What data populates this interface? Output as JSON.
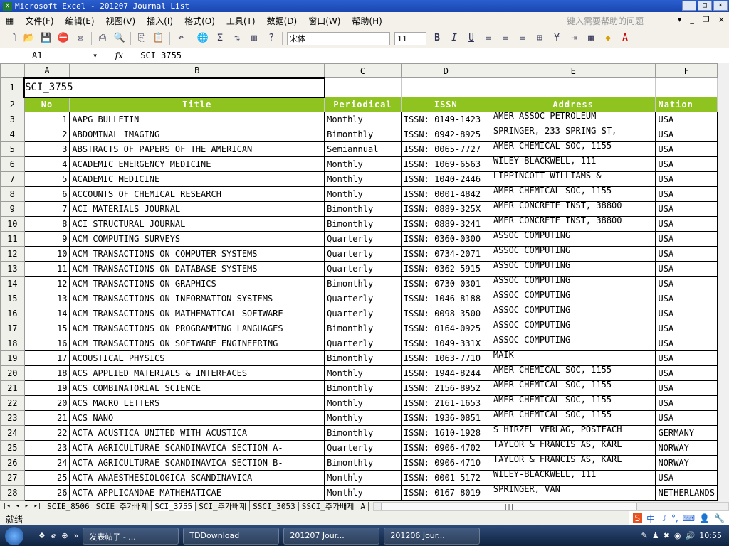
{
  "window": {
    "title": "Microsoft Excel - 201207 Journal List",
    "controls": [
      "_",
      "□",
      "×"
    ]
  },
  "menu": {
    "items": [
      "文件(F)",
      "编辑(E)",
      "视图(V)",
      "插入(I)",
      "格式(O)",
      "工具(T)",
      "数据(D)",
      "窗口(W)",
      "帮助(H)"
    ],
    "help_placeholder": "键入需要帮助的问题",
    "mdi": [
      "▾",
      "_",
      "❐",
      "×"
    ]
  },
  "toolbar": {
    "font": "宋体",
    "size": "11",
    "bold": "B",
    "italic": "I",
    "underline": "U",
    "sum": "Σ"
  },
  "formula": {
    "cell": "A1",
    "fx": "fx",
    "value": "SCI_3755"
  },
  "columns": [
    "A",
    "B",
    "C",
    "D",
    "E",
    "F"
  ],
  "sheet": {
    "a1": "SCI_3755",
    "headers": [
      "No",
      "Title",
      "Periodical",
      "ISSN",
      "Address",
      "Nation"
    ],
    "rows": [
      [
        "1",
        "AAPG BULLETIN",
        "Monthly",
        "ISSN: 0149-1423",
        "AMER ASSOC PETROLEUM",
        "USA"
      ],
      [
        "2",
        "ABDOMINAL IMAGING",
        "Bimonthly",
        "ISSN: 0942-8925",
        "SPRINGER, 233 SPRING ST,",
        "USA"
      ],
      [
        "3",
        "ABSTRACTS OF PAPERS OF THE AMERICAN",
        "Semiannual",
        "ISSN: 0065-7727",
        "AMER CHEMICAL SOC, 1155",
        "USA"
      ],
      [
        "4",
        "ACADEMIC EMERGENCY MEDICINE",
        "Monthly",
        "ISSN: 1069-6563",
        "WILEY-BLACKWELL, 111",
        "USA"
      ],
      [
        "5",
        "ACADEMIC MEDICINE",
        "Monthly",
        "ISSN: 1040-2446",
        "LIPPINCOTT WILLIAMS &",
        "USA"
      ],
      [
        "6",
        "ACCOUNTS OF CHEMICAL RESEARCH",
        "Monthly",
        "ISSN: 0001-4842",
        "AMER CHEMICAL SOC, 1155",
        "USA"
      ],
      [
        "7",
        "ACI MATERIALS JOURNAL",
        "Bimonthly",
        "ISSN: 0889-325X",
        "AMER CONCRETE INST, 38800",
        "USA"
      ],
      [
        "8",
        "ACI STRUCTURAL JOURNAL",
        "Bimonthly",
        "ISSN: 0889-3241",
        "AMER CONCRETE INST, 38800",
        "USA"
      ],
      [
        "9",
        "ACM COMPUTING SURVEYS",
        "Quarterly",
        "ISSN: 0360-0300",
        "ASSOC COMPUTING",
        "USA"
      ],
      [
        "10",
        "ACM TRANSACTIONS ON COMPUTER SYSTEMS",
        "Quarterly",
        "ISSN: 0734-2071",
        "ASSOC COMPUTING",
        "USA"
      ],
      [
        "11",
        "ACM TRANSACTIONS ON DATABASE SYSTEMS",
        "Quarterly",
        "ISSN: 0362-5915",
        "ASSOC COMPUTING",
        "USA"
      ],
      [
        "12",
        "ACM TRANSACTIONS ON GRAPHICS",
        "Bimonthly",
        "ISSN: 0730-0301",
        "ASSOC COMPUTING",
        "USA"
      ],
      [
        "13",
        "ACM TRANSACTIONS ON INFORMATION SYSTEMS",
        "Quarterly",
        "ISSN: 1046-8188",
        "ASSOC COMPUTING",
        "USA"
      ],
      [
        "14",
        "ACM TRANSACTIONS ON MATHEMATICAL SOFTWARE",
        "Quarterly",
        "ISSN: 0098-3500",
        "ASSOC COMPUTING",
        "USA"
      ],
      [
        "15",
        "ACM TRANSACTIONS ON PROGRAMMING LANGUAGES",
        "Bimonthly",
        "ISSN: 0164-0925",
        "ASSOC COMPUTING",
        "USA"
      ],
      [
        "16",
        "ACM TRANSACTIONS ON SOFTWARE ENGINEERING",
        "Quarterly",
        "ISSN: 1049-331X",
        "ASSOC COMPUTING",
        "USA"
      ],
      [
        "17",
        "ACOUSTICAL PHYSICS",
        "Bimonthly",
        "ISSN: 1063-7710",
        "MAIK",
        "USA"
      ],
      [
        "18",
        "ACS APPLIED MATERIALS & INTERFACES",
        "Monthly",
        "ISSN: 1944-8244",
        "AMER CHEMICAL SOC, 1155",
        "USA"
      ],
      [
        "19",
        "ACS COMBINATORIAL SCIENCE",
        "Bimonthly",
        "ISSN: 2156-8952",
        "AMER CHEMICAL SOC, 1155",
        "USA"
      ],
      [
        "20",
        "ACS MACRO LETTERS",
        "Monthly",
        "ISSN: 2161-1653",
        "AMER CHEMICAL SOC, 1155",
        "USA"
      ],
      [
        "21",
        "ACS NANO",
        "Monthly",
        "ISSN: 1936-0851",
        "AMER CHEMICAL SOC, 1155",
        "USA"
      ],
      [
        "22",
        "ACTA ACUSTICA UNITED WITH ACUSTICA",
        "Bimonthly",
        "ISSN: 1610-1928",
        "S HIRZEL VERLAG, POSTFACH",
        "GERMANY"
      ],
      [
        "23",
        "ACTA AGRICULTURAE SCANDINAVICA SECTION A-",
        "Quarterly",
        "ISSN: 0906-4702",
        "TAYLOR & FRANCIS AS, KARL",
        "NORWAY"
      ],
      [
        "24",
        "ACTA AGRICULTURAE SCANDINAVICA SECTION B-",
        "Bimonthly",
        "ISSN: 0906-4710",
        "TAYLOR & FRANCIS AS, KARL",
        "NORWAY"
      ],
      [
        "25",
        "ACTA ANAESTHESIOLOGICA SCANDINAVICA",
        "Monthly",
        "ISSN: 0001-5172",
        "WILEY-BLACKWELL, 111",
        "USA"
      ],
      [
        "26",
        "ACTA APPLICANDAE MATHEMATICAE",
        "Monthly",
        "ISSN: 0167-8019",
        "SPRINGER, VAN",
        "NETHERLANDS"
      ]
    ]
  },
  "tabs": [
    "SCIE_8506",
    "SCIE 추가배제",
    "SCI_3755",
    "SCI_추가배제",
    "SSCI_3053",
    "SSCI_추가배제",
    "A"
  ],
  "status": "就绪",
  "taskbar": {
    "items": [
      "发表帖子 - ...",
      "TDDownload",
      "201207 Jour...",
      "201206 Jour..."
    ],
    "clock": "10:55"
  }
}
